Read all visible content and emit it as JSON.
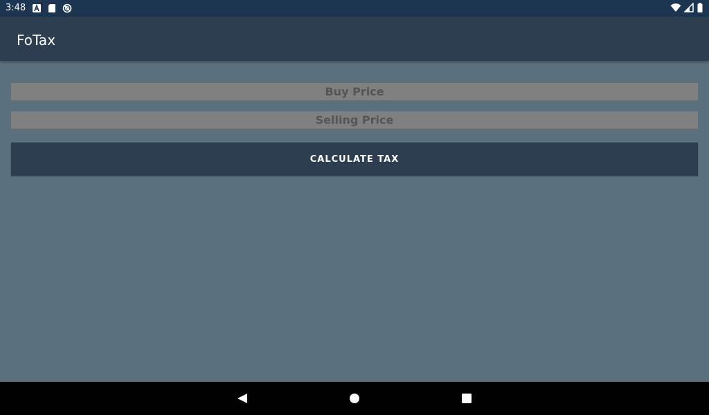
{
  "status_bar": {
    "time": "3:48",
    "left_icons": [
      "app-a-icon",
      "sd-card-icon",
      "sync-disabled-icon"
    ],
    "right_icons": [
      "wifi-icon",
      "cell-signal-icon",
      "battery-icon"
    ]
  },
  "app_bar": {
    "title": "FoTax"
  },
  "form": {
    "buy_price_placeholder": "Buy Price",
    "selling_price_placeholder": "Selling Price",
    "calculate_label": "CALCULATE TAX"
  },
  "nav_bar": {
    "buttons": [
      "back-icon",
      "home-icon",
      "recents-icon"
    ]
  },
  "colors": {
    "status_bar": "#1c3550",
    "app_bar": "#2c3e50",
    "background": "#5a707c",
    "field": "#808080",
    "button": "#2c3e50",
    "nav_bar": "#000000"
  }
}
